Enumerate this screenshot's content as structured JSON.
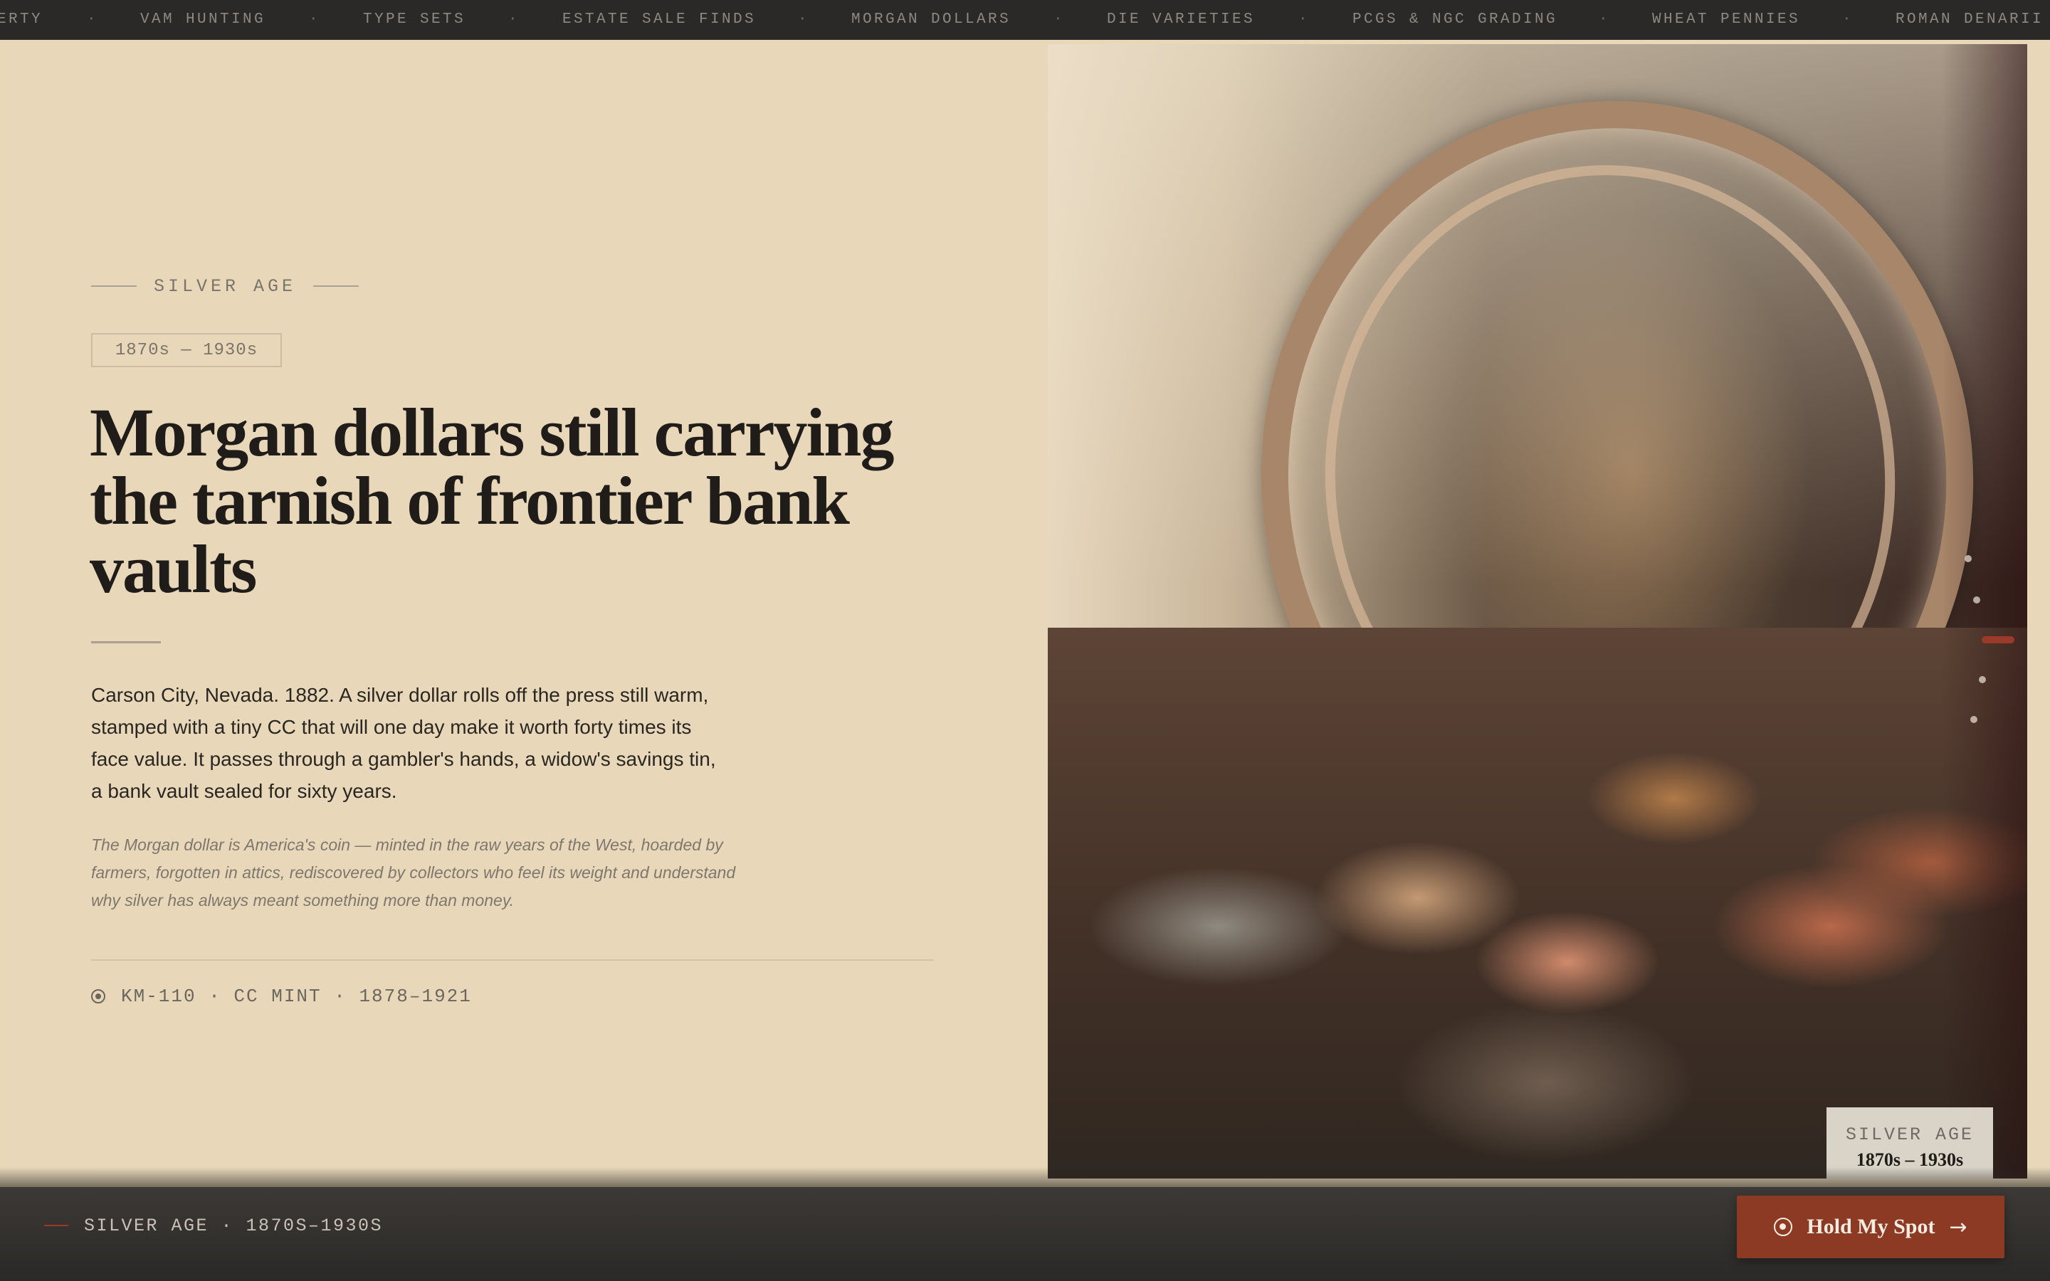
{
  "ticker": {
    "items": [
      "ERTY",
      "VAM HUNTING",
      "TYPE SETS",
      "ESTATE SALE FINDS",
      "MORGAN DOLLARS",
      "DIE VARIETIES",
      "PCGS & NGC GRADING",
      "WHEAT PENNIES",
      "ROMAN DENARII"
    ],
    "separator": "·"
  },
  "hero": {
    "eyebrow": "SILVER AGE",
    "era": "1870s — 1930s",
    "headline": "Morgan dollars still carrying the tarnish of frontier bank vaults",
    "body": "Carson City, Nevada. 1882. A silver dollar rolls off the press still warm, stamped with a tiny CC that will one day make it worth forty times its face value. It passes through a gambler's hands, a widow's savings tin, a bank vault sealed for sixty years.",
    "quote": "The Morgan dollar is America's coin — minted in the raw years of the West, hoarded by farmers, forgotten in attics, rediscovered by collectors who feel its weight and understand why silver has always meant something more than money.",
    "meta": "KM-110 · CC MINT · 1878–1921"
  },
  "image": {
    "icon": "coin-jar-photo",
    "caption_label": "SILVER AGE",
    "caption_range": "1870s – 1930s"
  },
  "slider": {
    "count": 5,
    "active_index": 2,
    "active_color": "#9b3a28"
  },
  "footer": {
    "label": "SILVER AGE · 1870S–1930S",
    "cta_label": "Hold My Spot",
    "cta_icon": "target-icon",
    "cta_arrow_icon": "arrow-right-icon",
    "accent": "#8c3a24"
  }
}
